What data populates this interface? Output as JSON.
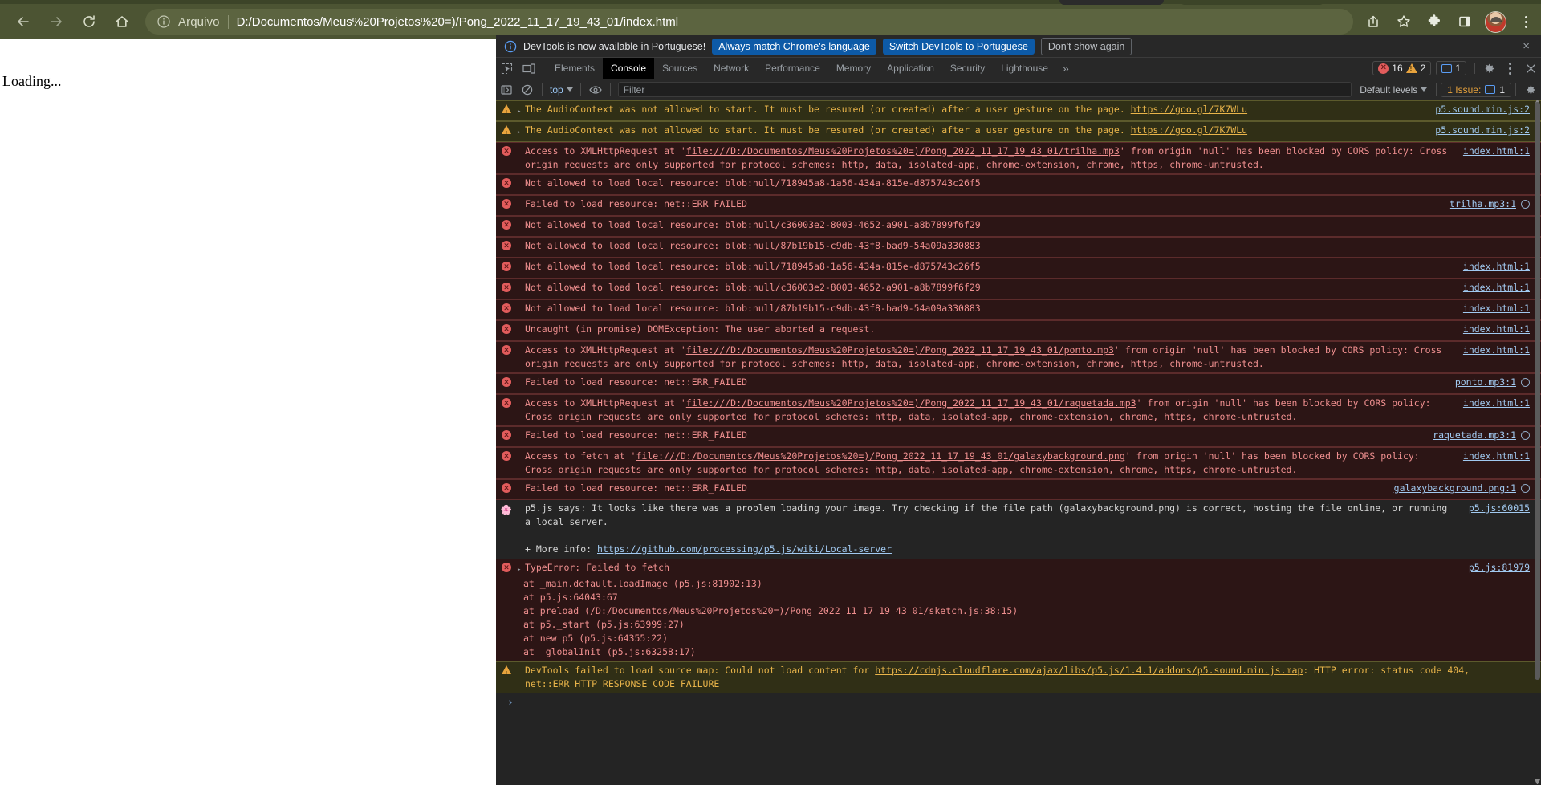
{
  "browser": {
    "nav": {
      "back_label": "Back",
      "forward_label": "Forward",
      "reload_label": "Reload",
      "home_label": "Home"
    },
    "omnibox": {
      "scheme_label": "Arquivo",
      "url": "D:/Documentos/Meus%20Projetos%20=)/Pong_2022_11_17_19_43_01/index.html"
    },
    "toolbar_icons": [
      "share-icon",
      "bookmark-star-icon",
      "extensions-puzzle-icon",
      "side-panel-icon",
      "profile-avatar",
      "chrome-menu-kebab"
    ],
    "theme_color": "#4c5433"
  },
  "page": {
    "body_text": "Loading..."
  },
  "devtools": {
    "notification": {
      "message": "DevTools is now available in Portuguese!",
      "primary_button": "Always match Chrome's language",
      "secondary_button": "Switch DevTools to Portuguese",
      "dismiss_button": "Don't show again",
      "close_label": "×"
    },
    "tabs": [
      {
        "label": "Elements",
        "active": false
      },
      {
        "label": "Console",
        "active": true
      },
      {
        "label": "Sources",
        "active": false
      },
      {
        "label": "Network",
        "active": false
      },
      {
        "label": "Performance",
        "active": false
      },
      {
        "label": "Memory",
        "active": false
      },
      {
        "label": "Application",
        "active": false
      },
      {
        "label": "Security",
        "active": false
      },
      {
        "label": "Lighthouse",
        "active": false
      }
    ],
    "more_tabs_label": "»",
    "counters": {
      "errors": "16",
      "warnings": "2",
      "infos": "1"
    },
    "console_toolbar": {
      "context": "top",
      "filter_placeholder": "Filter",
      "filter_value": "",
      "levels": "Default levels",
      "issues_label": "1 Issue:",
      "issues_count": "1"
    },
    "prompt": "›",
    "messages": [
      {
        "kind": "warn",
        "icon": "warning-icon",
        "expandable": true,
        "text": "The AudioContext was not allowed to start. It must be resumed (or created) after a user gesture on the page. ",
        "link": "https://goo.gl/7K7WLu",
        "source": "p5.sound.min.js:2",
        "has_context_icon": false
      },
      {
        "kind": "warn",
        "icon": "warning-icon",
        "expandable": true,
        "text": "The AudioContext was not allowed to start. It must be resumed (or created) after a user gesture on the page. ",
        "link": "https://goo.gl/7K7WLu",
        "source": "p5.sound.min.js:2",
        "has_context_icon": false
      },
      {
        "kind": "err",
        "icon": "error-icon",
        "expandable": false,
        "text": "Access to XMLHttpRequest at 'file:///D:/Documentos/Meus%20Projetos%20=)/Pong_2022_11_17_19_43_01/trilha.mp3' from origin 'null' has been blocked by CORS policy: Cross origin requests are only supported for protocol schemes: http, data, isolated-app, chrome-extension, chrome, https, chrome-untrusted.",
        "emphasis": "file:///D:/Documentos/Meus%20Projetos%20=)/Pong_2022_11_17_19_43_01/trilha.mp3",
        "source": "index.html:1",
        "has_context_icon": false
      },
      {
        "kind": "err",
        "icon": "error-icon",
        "expandable": false,
        "text": "Not allowed to load local resource: blob:null/718945a8-1a56-434a-815e-d875743c26f5",
        "source": "",
        "has_context_icon": false
      },
      {
        "kind": "err",
        "icon": "error-icon",
        "expandable": false,
        "text": "Failed to load resource: net::ERR_FAILED",
        "source": "trilha.mp3:1",
        "has_context_icon": true
      },
      {
        "kind": "err",
        "icon": "error-icon",
        "expandable": false,
        "text": "Not allowed to load local resource: blob:null/c36003e2-8003-4652-a901-a8b7899f6f29",
        "source": "",
        "has_context_icon": false
      },
      {
        "kind": "err",
        "icon": "error-icon",
        "expandable": false,
        "text": "Not allowed to load local resource: blob:null/87b19b15-c9db-43f8-bad9-54a09a330883",
        "source": "",
        "has_context_icon": false
      },
      {
        "kind": "err",
        "icon": "error-icon",
        "expandable": false,
        "text": "Not allowed to load local resource: blob:null/718945a8-1a56-434a-815e-d875743c26f5",
        "source": "index.html:1",
        "has_context_icon": false
      },
      {
        "kind": "err",
        "icon": "error-icon",
        "expandable": false,
        "text": "Not allowed to load local resource: blob:null/c36003e2-8003-4652-a901-a8b7899f6f29",
        "source": "index.html:1",
        "has_context_icon": false
      },
      {
        "kind": "err",
        "icon": "error-icon",
        "expandable": false,
        "text": "Not allowed to load local resource: blob:null/87b19b15-c9db-43f8-bad9-54a09a330883",
        "source": "index.html:1",
        "has_context_icon": false
      },
      {
        "kind": "err",
        "icon": "error-icon",
        "expandable": false,
        "text": "Uncaught (in promise) DOMException: The user aborted a request.",
        "source": "index.html:1",
        "has_context_icon": false
      },
      {
        "kind": "err",
        "icon": "error-icon",
        "expandable": false,
        "text": "Access to XMLHttpRequest at 'file:///D:/Documentos/Meus%20Projetos%20=)/Pong_2022_11_17_19_43_01/ponto.mp3' from origin 'null' has been blocked by CORS policy: Cross origin requests are only supported for protocol schemes: http, data, isolated-app, chrome-extension, chrome, https, chrome-untrusted.",
        "emphasis": "file:///D:/Documentos/Meus%20Projetos%20=)/Pong_2022_11_17_19_43_01/ponto.mp3",
        "source": "index.html:1",
        "has_context_icon": false
      },
      {
        "kind": "err",
        "icon": "error-icon",
        "expandable": false,
        "text": "Failed to load resource: net::ERR_FAILED",
        "source": "ponto.mp3:1",
        "has_context_icon": true
      },
      {
        "kind": "err",
        "icon": "error-icon",
        "expandable": false,
        "text": "Access to XMLHttpRequest at 'file:///D:/Documentos/Meus%20Projetos%20=)/Pong_2022_11_17_19_43_01/raquetada.mp3' from origin 'null' has been blocked by CORS policy: Cross origin requests are only supported for protocol schemes: http, data, isolated-app, chrome-extension, chrome, https, chrome-untrusted.",
        "emphasis": "file:///D:/Documentos/Meus%20Projetos%20=)/Pong_2022_11_17_19_43_01/raquetada.mp3",
        "source": "index.html:1",
        "has_context_icon": false
      },
      {
        "kind": "err",
        "icon": "error-icon",
        "expandable": false,
        "text": "Failed to load resource: net::ERR_FAILED",
        "source": "raquetada.mp3:1",
        "has_context_icon": true
      },
      {
        "kind": "err",
        "icon": "error-icon",
        "expandable": false,
        "text": "Access to fetch at 'file:///D:/Documentos/Meus%20Projetos%20=)/Pong_2022_11_17_19_43_01/galaxybackground.png' from origin 'null' has been blocked by CORS policy: Cross origin requests are only supported for protocol schemes: http, data, isolated-app, chrome-extension, chrome, https, chrome-untrusted.",
        "emphasis": "file:///D:/Documentos/Meus%20Projetos%20=)/Pong_2022_11_17_19_43_01/galaxybackground.png",
        "source": "index.html:1",
        "has_context_icon": false
      },
      {
        "kind": "err",
        "icon": "error-icon",
        "expandable": false,
        "text": "Failed to load resource: net::ERR_FAILED",
        "source": "galaxybackground.png:1",
        "has_context_icon": true
      }
    ],
    "p5_message": {
      "icon": "p5-flower-icon",
      "line1": "p5.js says: It looks like there was a problem loading your image. Try checking if the file path (galaxybackground.png) is correct, hosting the file online, or running a local server.",
      "more_info_prefix": "+ More info: ",
      "more_info_link": "https://github.com/processing/p5.js/wiki/Local-server",
      "source": "p5.js:60015"
    },
    "type_error": {
      "icon": "error-icon",
      "title": "TypeError: Failed to fetch",
      "source": "p5.js:81979",
      "stack": [
        {
          "at": "at _main.default.loadImage (",
          "link": "p5.js:81902:13",
          "close": ")"
        },
        {
          "at": "at ",
          "link": "p5.js:64043:67",
          "close": ""
        },
        {
          "at": "at preload (",
          "link": "/D:/Documentos/Meus%20Projetos%20=)/Pong_2022_11_17_19_43_01/sketch.js:38",
          "close": ":15)"
        },
        {
          "at": "at p5._start (",
          "link": "p5.js:63999:27",
          "close": ")"
        },
        {
          "at": "at new p5 (",
          "link": "p5.js:64355:22",
          "close": ")"
        },
        {
          "at": "at _globalInit (",
          "link": "p5.js:63258:17",
          "close": ")"
        }
      ]
    },
    "sourcemap_warning": {
      "icon": "warning-icon",
      "prefix": "DevTools failed to load source map: Could not load content for ",
      "link": "https://cdnjs.cloudflare.com/ajax/libs/p5.js/1.4.1/addons/p5.sound.min.js.map",
      "suffix": ": HTTP error: status code 404, net::ERR_HTTP_RESPONSE_CODE_FAILURE"
    }
  }
}
